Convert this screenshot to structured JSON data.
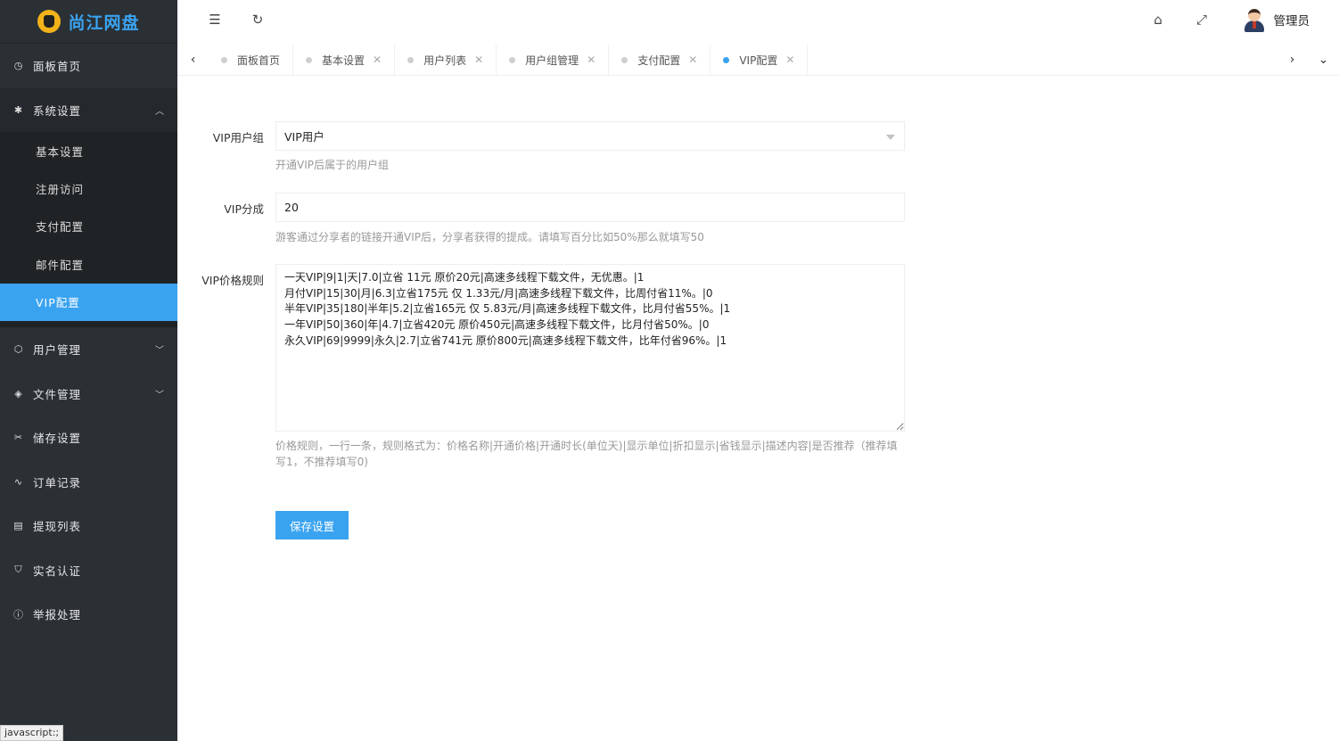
{
  "brand": {
    "name": "尚江网盘"
  },
  "sidebar": {
    "items": [
      {
        "label": "面板首页",
        "icon": "dashboard-icon"
      },
      {
        "label": "系统设置",
        "icon": "gear-icon",
        "expanded": true
      },
      {
        "label": "用户管理",
        "icon": "cube-icon"
      },
      {
        "label": "文件管理",
        "icon": "layers-icon"
      },
      {
        "label": "储存设置",
        "icon": "storage-icon"
      },
      {
        "label": "订单记录",
        "icon": "pulse-icon"
      },
      {
        "label": "提现列表",
        "icon": "list-icon"
      },
      {
        "label": "实名认证",
        "icon": "shield-icon"
      },
      {
        "label": "举报处理",
        "icon": "alert-icon"
      }
    ],
    "system_sub": [
      {
        "label": "基本设置"
      },
      {
        "label": "注册访问"
      },
      {
        "label": "支付配置"
      },
      {
        "label": "邮件配置"
      },
      {
        "label": "VIP配置",
        "active": true
      }
    ]
  },
  "header": {
    "user_name": "管理员"
  },
  "tabs": [
    {
      "label": "面板首页",
      "closable": false
    },
    {
      "label": "基本设置",
      "closable": true
    },
    {
      "label": "用户列表",
      "closable": true
    },
    {
      "label": "用户组管理",
      "closable": true
    },
    {
      "label": "支付配置",
      "closable": true
    },
    {
      "label": "VIP配置",
      "closable": true,
      "active": true
    }
  ],
  "form": {
    "vip_group": {
      "label": "VIP用户组",
      "value": "VIP用户",
      "help": "开通VIP后属于的用户组"
    },
    "vip_share": {
      "label": "VIP分成",
      "value": "20",
      "help": "游客通过分享者的链接开通VIP后，分享者获得的提成。请填写百分比如50%那么就填写50"
    },
    "vip_rules": {
      "label": "VIP价格规则",
      "value": "一天VIP|9|1|天|7.0|立省 11元 原价20元|高速多线程下载文件，无优惠。|1\n月付VIP|15|30|月|6.3|立省175元 仅 1.33元/月|高速多线程下载文件，比周付省11%。|0\n半年VIP|35|180|半年|5.2|立省165元 仅 5.83元/月|高速多线程下载文件，比月付省55%。|1\n一年VIP|50|360|年|4.7|立省420元 原价450元|高速多线程下载文件，比月付省50%。|0\n永久VIP|69|9999|永久|2.7|立省741元 原价800元|高速多线程下载文件，比年付省96%。|1",
      "help": "价格规则，一行一条，规则格式为：价格名称|开通价格|开通时长(单位天)|显示单位|折扣显示|省钱显示|描述内容|是否推荐（推荐填写1，不推荐填写0)"
    },
    "save_label": "保存设置"
  },
  "status_bar": {
    "text": "javascript:;"
  },
  "colors": {
    "accent": "#3aa3f0",
    "sidebar_bg": "#2b3035",
    "submenu_bg": "#1f2326"
  }
}
